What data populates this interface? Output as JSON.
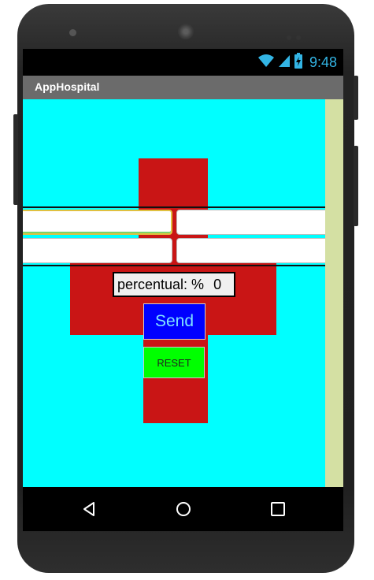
{
  "status_bar": {
    "time": "9:48",
    "icons": [
      "wifi-icon",
      "cellular-signal-icon",
      "battery-icon"
    ],
    "icon_color": "#33b5e5"
  },
  "app": {
    "title": "AppHospital"
  },
  "colors": {
    "content_bg": "#00ffff",
    "cross_red": "#c91515",
    "send_bg": "#0000ff",
    "send_text": "#7fe3ff",
    "reset_bg": "#00ff00",
    "scroll_track": "#d4e0a3",
    "title_bar": "#6b6b6b"
  },
  "form": {
    "fields": [
      {
        "value": "",
        "placeholder": ""
      },
      {
        "value": "",
        "placeholder": ""
      },
      {
        "value": "",
        "placeholder": ""
      },
      {
        "value": "",
        "placeholder": ""
      }
    ],
    "percent_label": "percentual: %",
    "percent_value": "0",
    "send_label": "Send",
    "reset_label": "RESET"
  },
  "nav_bar": {
    "icons": [
      "back-icon",
      "home-icon",
      "recents-icon"
    ]
  }
}
